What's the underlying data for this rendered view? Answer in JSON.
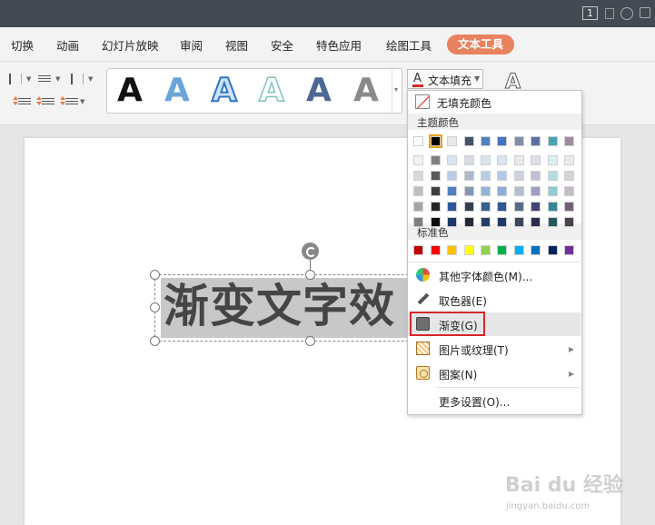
{
  "titlebar": {
    "badge": "1"
  },
  "menu": {
    "items": [
      "切换",
      "动画",
      "幻灯片放映",
      "审阅",
      "视图",
      "安全",
      "特色应用",
      "绘图工具"
    ],
    "active": "文本工具"
  },
  "toolbar": {
    "gallery_letter": "A",
    "fill_button": "文本填充",
    "outline_letter": "A"
  },
  "slide": {
    "text": "渐变文字效"
  },
  "dropdown": {
    "no_fill": "无填充颜色",
    "theme_colors_label": "主题颜色",
    "theme_top_row": [
      "#ffffff",
      "#000000",
      "#e8e8e8",
      "#44546a",
      "#4f81bd",
      "#4472c4",
      "#7f8fa9",
      "#5a6fa0",
      "#4aa3b0",
      "#9e8c9e"
    ],
    "theme_shades": [
      [
        "#f2f2f2",
        "#7f7f7f",
        "#dbe5f1",
        "#d6dce4",
        "#dce6f2",
        "#d9e4f5",
        "#e6e9ee",
        "#dedfea",
        "#d9eef0",
        "#ece8ec"
      ],
      [
        "#d9d9d9",
        "#595959",
        "#b8cce4",
        "#acb9ca",
        "#b9cde5",
        "#b4c7e7",
        "#cdd3dd",
        "#bebfd5",
        "#b3dde2",
        "#d8d1d8"
      ],
      [
        "#bfbfbf",
        "#3f3f3f",
        "#4f81bd",
        "#8496b0",
        "#95b3d7",
        "#8faadc",
        "#b4bdcd",
        "#9d9fc0",
        "#8dccd4",
        "#c5bac5"
      ],
      [
        "#a5a5a5",
        "#262626",
        "#2a5699",
        "#333f50",
        "#366092",
        "#2f5597",
        "#5a6b86",
        "#414278",
        "#348893",
        "#746074"
      ],
      [
        "#7f7f7f",
        "#0c0c0c",
        "#1a3966",
        "#222a35",
        "#244062",
        "#1f3864",
        "#3c475a",
        "#2b2c50",
        "#235b62",
        "#4d404d"
      ]
    ],
    "standard_colors_label": "标准色",
    "standard_colors": [
      "#c00000",
      "#ff0000",
      "#ffc000",
      "#ffff00",
      "#92d050",
      "#00b050",
      "#00b0f0",
      "#0070c0",
      "#002060",
      "#7030a0"
    ],
    "other_colors": "其他字体颜色(M)...",
    "eyedropper": "取色器(E)",
    "gradient": "渐变(G)",
    "picture_texture": "图片或纹理(T)",
    "pattern": "图案(N)",
    "more_settings": "更多设置(O)..."
  },
  "watermark": {
    "main": "Bai du 经验",
    "sub": "jingyan.baidu.com"
  }
}
